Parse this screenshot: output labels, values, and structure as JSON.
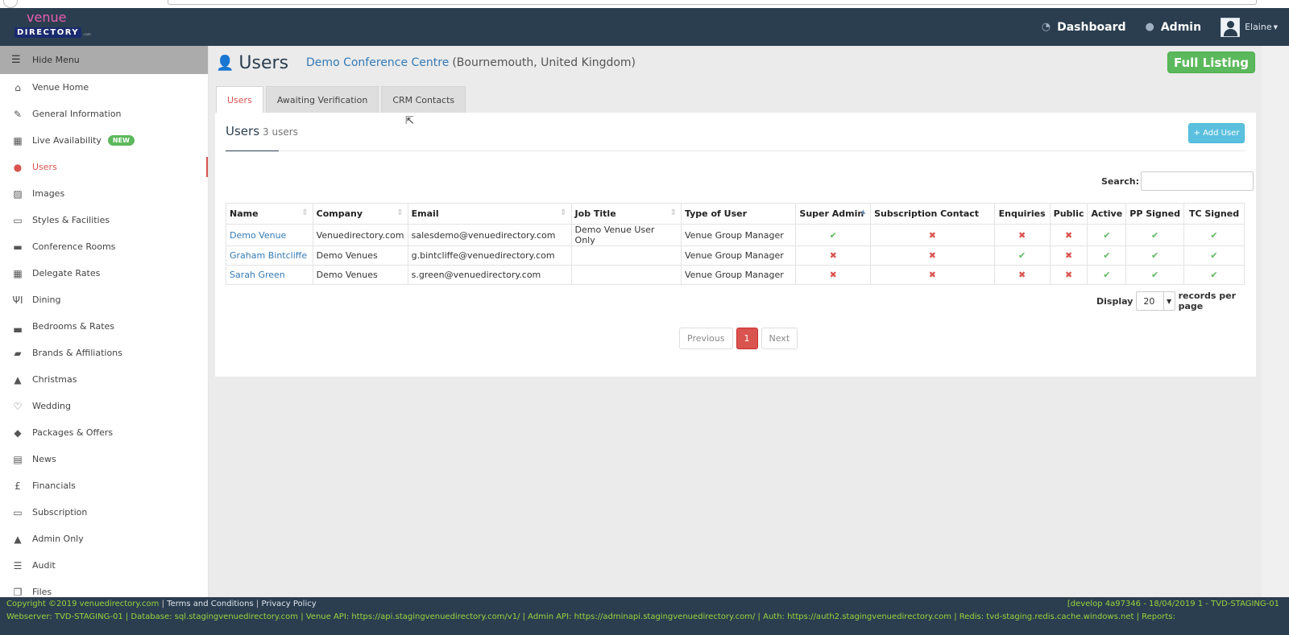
{
  "navbar": {
    "logo_top": "venue",
    "logo_main": "DIRECTORY",
    "logo_suffix": ".com",
    "dashboard_label": "Dashboard",
    "admin_label": "Admin",
    "user_name": "Elaine"
  },
  "sidebar": {
    "hide_label": "Hide Menu",
    "new_badge": "NEW",
    "items": [
      {
        "label": "Venue Home",
        "icon": "home-icon"
      },
      {
        "label": "General Information",
        "icon": "edit-icon"
      },
      {
        "label": "Live Availability",
        "icon": "calendar-icon"
      },
      {
        "label": "Users",
        "icon": "user-icon"
      },
      {
        "label": "Images",
        "icon": "image-icon"
      },
      {
        "label": "Styles & Facilities",
        "icon": "monitor-icon"
      },
      {
        "label": "Conference Rooms",
        "icon": "briefcase-icon"
      },
      {
        "label": "Delegate Rates",
        "icon": "calculator-icon"
      },
      {
        "label": "Dining",
        "icon": "cutlery-icon"
      },
      {
        "label": "Bedrooms & Rates",
        "icon": "bed-icon"
      },
      {
        "label": "Brands & Affiliations",
        "icon": "book-icon"
      },
      {
        "label": "Christmas",
        "icon": "tree-icon"
      },
      {
        "label": "Wedding",
        "icon": "heart-icon"
      },
      {
        "label": "Packages & Offers",
        "icon": "tags-icon"
      },
      {
        "label": "News",
        "icon": "newspaper-icon"
      },
      {
        "label": "Financials",
        "icon": "pound-icon"
      },
      {
        "label": "Subscription",
        "icon": "credit-card-icon"
      },
      {
        "label": "Admin Only",
        "icon": "warning-icon"
      },
      {
        "label": "Audit",
        "icon": "list-icon"
      },
      {
        "label": "Files",
        "icon": "files-icon"
      }
    ]
  },
  "page": {
    "title": "Users",
    "venue_name": "Demo Conference Centre",
    "venue_location": "(Bournemouth, United Kingdom)",
    "full_listing_label": "Full Listing"
  },
  "tabs": [
    "Users",
    "Awaiting Verification",
    "CRM Contacts"
  ],
  "panel": {
    "title": "Users",
    "count": "3 users",
    "add_user_label": "+ Add User",
    "search_label": "Search:",
    "display_label": "Display",
    "per_page_value": "20",
    "records_label": "records per page",
    "previous_label": "Previous",
    "page_number": "1",
    "next_label": "Next"
  },
  "table": {
    "headers": [
      "Name",
      "Company",
      "Email",
      "Job Title",
      "Type of User",
      "Super Admin",
      "Subscription Contact",
      "Enquiries",
      "Public",
      "Active",
      "PP Signed",
      "TC Signed"
    ],
    "rows": [
      {
        "name": "Demo Venue",
        "company": "Venuedirectory.com",
        "email": "salesdemo@venuedirectory.com",
        "job": "Demo Venue User Only",
        "type": "Venue Group Manager",
        "flags": [
          true,
          false,
          false,
          false,
          true,
          true,
          true
        ]
      },
      {
        "name": "Graham Bintcliffe",
        "company": "Demo Venues",
        "email": "g.bintcliffe@venuedirectory.com",
        "job": "",
        "type": "Venue Group Manager",
        "flags": [
          false,
          false,
          true,
          false,
          true,
          true,
          true
        ]
      },
      {
        "name": "Sarah Green",
        "company": "Demo Venues",
        "email": "s.green@venuedirectory.com",
        "job": "",
        "type": "Venue Group Manager",
        "flags": [
          false,
          false,
          false,
          false,
          true,
          true,
          true
        ]
      }
    ]
  },
  "footer": {
    "copyright": "Copyright ©2019 venuedirectory.com",
    "terms": "Terms and Conditions",
    "privacy": "Privacy Policy",
    "build": "[develop 4a97346 - 18/04/2019 1 - TVD-STAGING-01",
    "server_line": "Webserver: TVD-STAGING-01 | Database: sql.stagingvenuedirectory.com | Venue API: https://api.stagingvenuedirectory.com/v1/ | Admin API: https://adminapi.stagingvenuedirectory.com/ | Auth: https://auth2.stagingvenuedirectory.com | Redis: tvd-staging.redis.cache.windows.net | Reports:"
  },
  "colors": {
    "navbar": "#2b3e50",
    "accent_red": "#d9534f",
    "success": "#5cb85c",
    "info": "#5bc0de",
    "link": "#337ab7"
  }
}
